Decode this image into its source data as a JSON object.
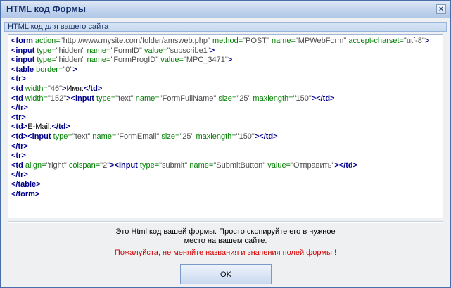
{
  "window": {
    "title": "HTML код Формы",
    "close_label": "×"
  },
  "panel": {
    "header": "HTML код для вашего сайта"
  },
  "code_lines": [
    [
      [
        "tag",
        "<form"
      ],
      [
        "attr",
        " action="
      ],
      [
        "val",
        "\"http://www.mysite.com/folder/amsweb.php\""
      ],
      [
        "attr",
        " method="
      ],
      [
        "val",
        "\"POST\""
      ],
      [
        "attr",
        " name="
      ],
      [
        "val",
        "\"MPWebForm\""
      ],
      [
        "attr",
        " accept-charset="
      ],
      [
        "val",
        "\"utf-8\""
      ],
      [
        "tag",
        ">"
      ]
    ],
    [
      [
        "tag",
        "<input"
      ],
      [
        "attr",
        " type="
      ],
      [
        "val",
        "\"hidden\""
      ],
      [
        "attr",
        " name="
      ],
      [
        "val",
        "\"FormID\""
      ],
      [
        "attr",
        " value="
      ],
      [
        "val",
        "\"subscribe1\""
      ],
      [
        "tag",
        ">"
      ]
    ],
    [
      [
        "tag",
        "<input"
      ],
      [
        "attr",
        " type="
      ],
      [
        "val",
        "\"hidden\""
      ],
      [
        "attr",
        " name="
      ],
      [
        "val",
        "\"FormProgID\""
      ],
      [
        "attr",
        " value="
      ],
      [
        "val",
        "\"MPC_3471\""
      ],
      [
        "tag",
        ">"
      ]
    ],
    [
      [
        "tag",
        "<table"
      ],
      [
        "attr",
        " border="
      ],
      [
        "val",
        "\"0\""
      ],
      [
        "tag",
        ">"
      ]
    ],
    [
      [
        "tag",
        "<tr>"
      ]
    ],
    [
      [
        "tag",
        "<td"
      ],
      [
        "attr",
        " width="
      ],
      [
        "val",
        "\"46\""
      ],
      [
        "tag",
        ">"
      ],
      [
        "txt",
        "Имя:"
      ],
      [
        "tag",
        "</td>"
      ]
    ],
    [
      [
        "tag",
        "<td"
      ],
      [
        "attr",
        " width="
      ],
      [
        "val",
        "\"152\""
      ],
      [
        "tag",
        "><input"
      ],
      [
        "attr",
        " type="
      ],
      [
        "val",
        "\"text\""
      ],
      [
        "attr",
        " name="
      ],
      [
        "val",
        "\"FormFullName\""
      ],
      [
        "attr",
        " size="
      ],
      [
        "val",
        "\"25\""
      ],
      [
        "attr",
        " maxlength="
      ],
      [
        "val",
        "\"150\""
      ],
      [
        "tag",
        "></td>"
      ]
    ],
    [
      [
        "tag",
        "</tr>"
      ]
    ],
    [
      [
        "tag",
        "<tr>"
      ]
    ],
    [
      [
        "tag",
        "<td>"
      ],
      [
        "txt",
        "E-Mail:"
      ],
      [
        "tag",
        "</td>"
      ]
    ],
    [
      [
        "tag",
        "<td><input"
      ],
      [
        "attr",
        " type="
      ],
      [
        "val",
        "\"text\""
      ],
      [
        "attr",
        " name="
      ],
      [
        "val",
        "\"FormEmail\""
      ],
      [
        "attr",
        " size="
      ],
      [
        "val",
        "\"25\""
      ],
      [
        "attr",
        " maxlength="
      ],
      [
        "val",
        "\"150\""
      ],
      [
        "tag",
        "></td>"
      ]
    ],
    [
      [
        "tag",
        "</tr>"
      ]
    ],
    [
      [
        "tag",
        "<tr>"
      ]
    ],
    [
      [
        "tag",
        "<td"
      ],
      [
        "attr",
        " align="
      ],
      [
        "val",
        "\"right\""
      ],
      [
        "attr",
        " colspan="
      ],
      [
        "val",
        "\"2\""
      ],
      [
        "tag",
        "><input"
      ],
      [
        "attr",
        " type="
      ],
      [
        "val",
        "\"submit\""
      ],
      [
        "attr",
        " name="
      ],
      [
        "val",
        "\"SubmitButton\""
      ],
      [
        "attr",
        " value="
      ],
      [
        "val",
        "\"Отправить\""
      ],
      [
        "tag",
        "></td>"
      ]
    ],
    [
      [
        "tag",
        "</tr>"
      ]
    ],
    [
      [
        "tag",
        "</table>"
      ]
    ],
    [
      [
        "tag",
        "</form>"
      ]
    ]
  ],
  "info": {
    "line1": "Это Html код вашей формы. Просто скопируйте его в нужное",
    "line2": "место на вашем сайте.",
    "warning": "Пожалуйста, не меняйте названия и значения полей формы !"
  },
  "buttons": {
    "ok_label": "OK"
  },
  "colors": {
    "tag": "#00008b",
    "attr": "#008000",
    "value": "#4b4b4b",
    "warning": "#d40000"
  }
}
